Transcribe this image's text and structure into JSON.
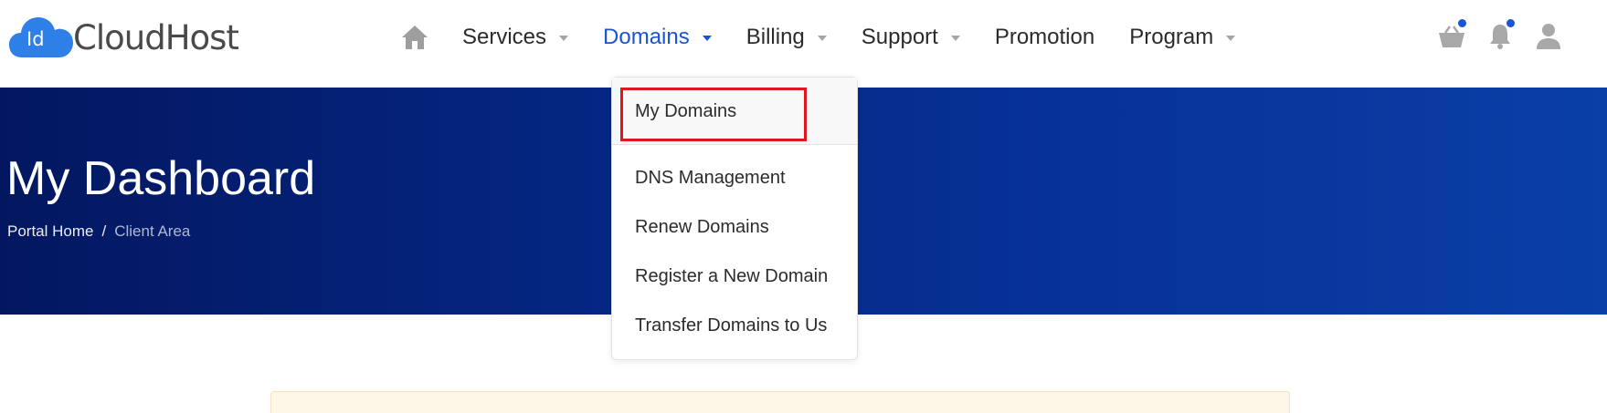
{
  "brand": {
    "abbr": "Id",
    "name": "CloudHost",
    "cloud_color": "#2f7fe8"
  },
  "nav": {
    "items": [
      {
        "label": "Services",
        "has_caret": true
      },
      {
        "label": "Domains",
        "has_caret": true,
        "active": true
      },
      {
        "label": "Billing",
        "has_caret": true
      },
      {
        "label": "Support",
        "has_caret": true
      },
      {
        "label": "Promotion",
        "has_caret": false
      },
      {
        "label": "Program",
        "has_caret": true
      }
    ],
    "active_color": "#1a54d6"
  },
  "header_icons": [
    "basket-icon",
    "bell-icon",
    "user-icon"
  ],
  "hero": {
    "title": "My Dashboard",
    "breadcrumb": {
      "home": "Portal Home",
      "separator": "/",
      "current": "Client Area"
    }
  },
  "dropdown": {
    "items": [
      "My Domains",
      "DNS Management",
      "Renew Domains",
      "Register a New Domain",
      "Transfer Domains to Us"
    ],
    "highlight_color": "#e0161c"
  }
}
